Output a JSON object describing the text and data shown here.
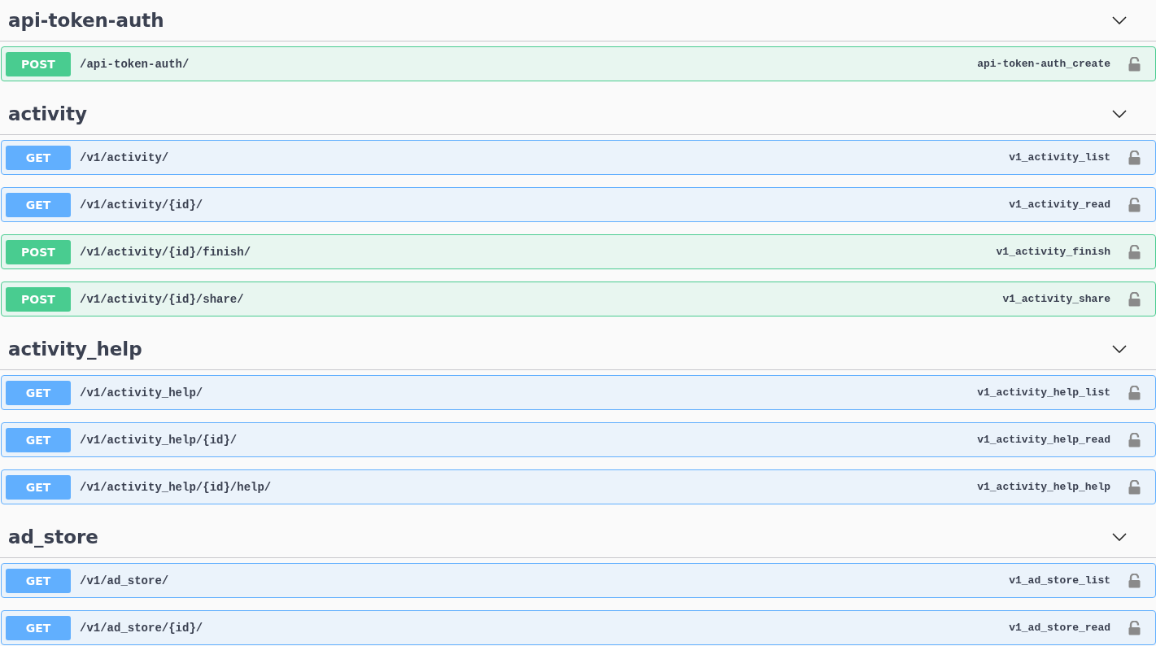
{
  "sections": [
    {
      "name": "api-token-auth",
      "expanded": true,
      "operations": [
        {
          "method": "POST",
          "path": "/api-token-auth/",
          "operation_id": "api-token-auth_create"
        }
      ]
    },
    {
      "name": "activity",
      "expanded": true,
      "operations": [
        {
          "method": "GET",
          "path": "/v1/activity/",
          "operation_id": "v1_activity_list"
        },
        {
          "method": "GET",
          "path": "/v1/activity/{id}/",
          "operation_id": "v1_activity_read"
        },
        {
          "method": "POST",
          "path": "/v1/activity/{id}/finish/",
          "operation_id": "v1_activity_finish"
        },
        {
          "method": "POST",
          "path": "/v1/activity/{id}/share/",
          "operation_id": "v1_activity_share"
        }
      ]
    },
    {
      "name": "activity_help",
      "expanded": true,
      "operations": [
        {
          "method": "GET",
          "path": "/v1/activity_help/",
          "operation_id": "v1_activity_help_list"
        },
        {
          "method": "GET",
          "path": "/v1/activity_help/{id}/",
          "operation_id": "v1_activity_help_read"
        },
        {
          "method": "GET",
          "path": "/v1/activity_help/{id}/help/",
          "operation_id": "v1_activity_help_help"
        }
      ]
    },
    {
      "name": "ad_store",
      "expanded": true,
      "operations": [
        {
          "method": "GET",
          "path": "/v1/ad_store/",
          "operation_id": "v1_ad_store_list"
        },
        {
          "method": "GET",
          "path": "/v1/ad_store/{id}/",
          "operation_id": "v1_ad_store_read"
        }
      ]
    }
  ]
}
